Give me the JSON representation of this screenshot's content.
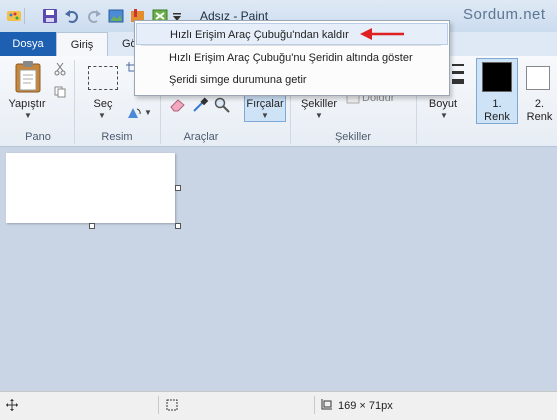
{
  "window": {
    "title": "Adsız - Paint",
    "watermark": "Sordum.net"
  },
  "tabs": [
    {
      "label": "Dosya"
    },
    {
      "label": "Giriş"
    },
    {
      "label": "Gö"
    }
  ],
  "ribbon": {
    "clipboard": {
      "paste_label": "Yapıştır",
      "group_label": "Pano"
    },
    "image": {
      "select_label": "Seç",
      "group_label": "Resim"
    },
    "tools": {
      "group_label": "Araçlar"
    },
    "brushes": {
      "label": "Fırçalar"
    },
    "shapes": {
      "label": "Şekiller",
      "group_label": "Şekiller",
      "fill_label": "Doldur"
    },
    "size": {
      "label": "Boyut"
    },
    "color1": {
      "label_top": "1.",
      "label_bottom": "Renk",
      "color": "#000000"
    },
    "color2": {
      "label_top": "2.",
      "label_bottom": "Renk",
      "color": "#ffffff"
    }
  },
  "menu": {
    "items": [
      {
        "label": "Hızlı Erişim Araç Çubuğu'ndan kaldır"
      },
      {
        "label": "Hızlı Erişim Araç Çubuğu'nu Şeridin altında göster"
      },
      {
        "label": "Şeridi simge durumuna getir"
      }
    ]
  },
  "status": {
    "image_size": "169 × 71px"
  },
  "colors": {
    "file_tab": "#1d5fb0",
    "arrow": "#e02020",
    "workarea": "#c9d5e5"
  }
}
